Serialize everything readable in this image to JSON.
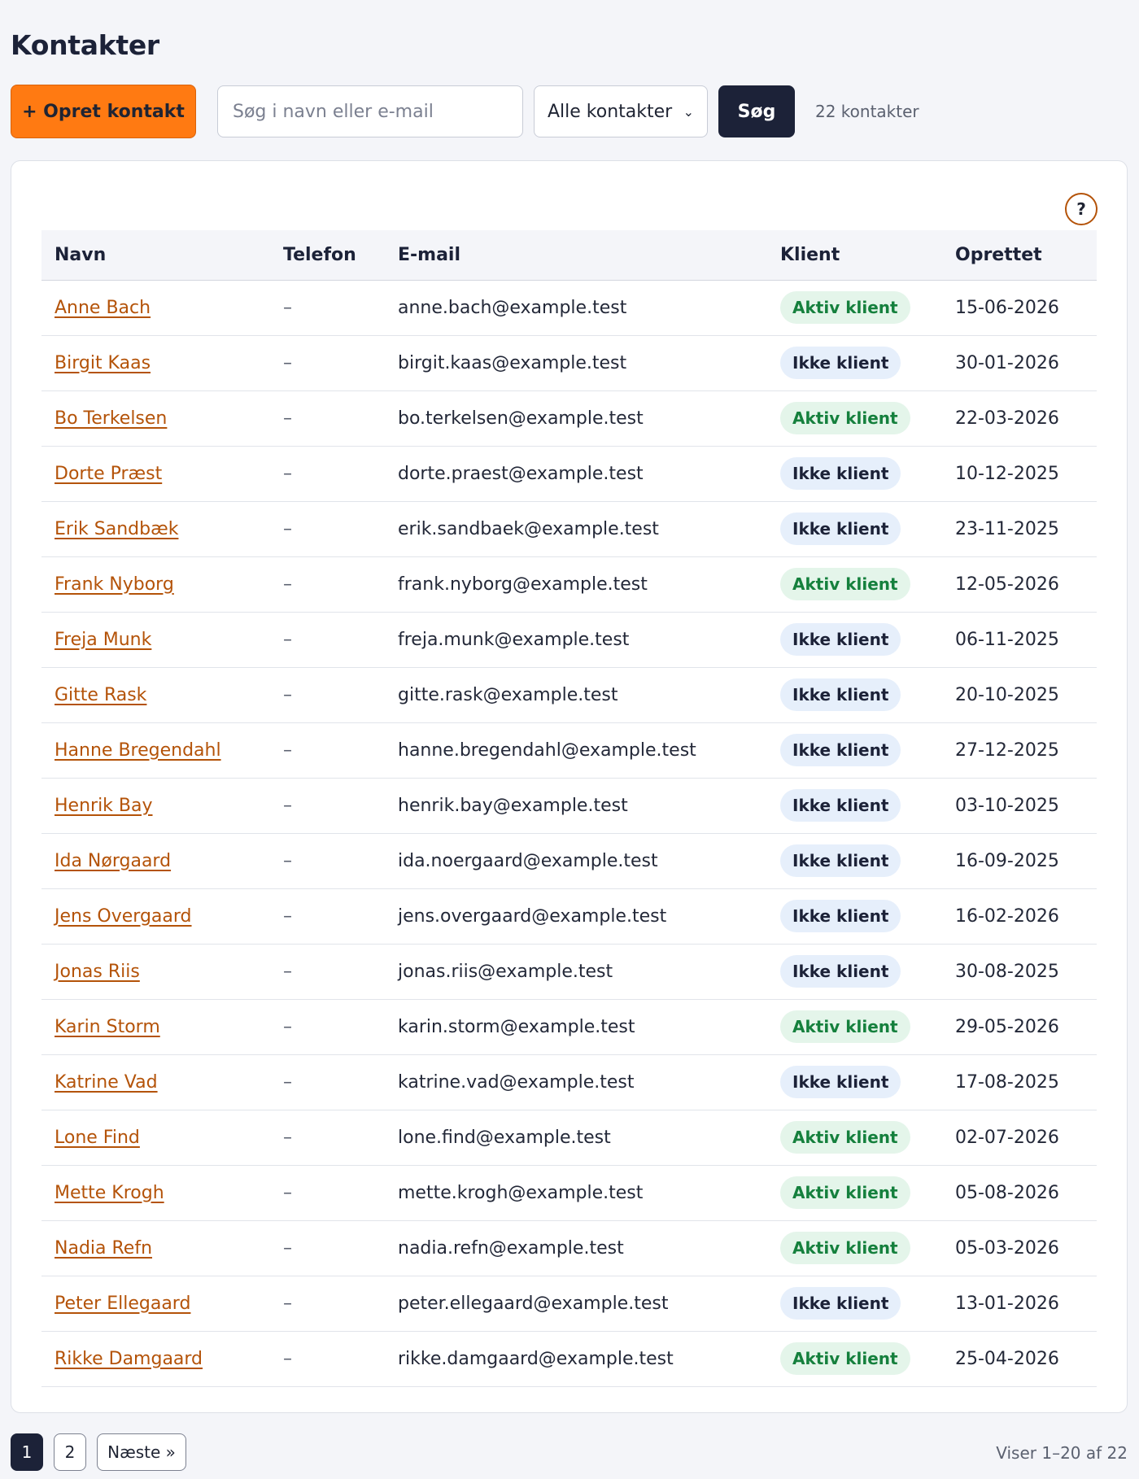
{
  "page_title": "Kontakter",
  "toolbar": {
    "create_label": "+ Opret kontakt",
    "search_placeholder": "Søg i navn eller e-mail",
    "filter_selected": "Alle kontakter",
    "search_label": "Søg",
    "count_text": "22 kontakter"
  },
  "help_icon": "?",
  "table": {
    "headers": [
      "Navn",
      "Telefon",
      "E-mail",
      "Klient",
      "Oprettet"
    ],
    "rows": [
      {
        "name": "Anne Bach",
        "phone": "–",
        "email": "anne.bach@example.test",
        "client": "Aktiv klient",
        "active": true,
        "created": "15-06-2026"
      },
      {
        "name": "Birgit Kaas",
        "phone": "–",
        "email": "birgit.kaas@example.test",
        "client": "Ikke klient",
        "active": false,
        "created": "30-01-2026"
      },
      {
        "name": "Bo Terkelsen",
        "phone": "–",
        "email": "bo.terkelsen@example.test",
        "client": "Aktiv klient",
        "active": true,
        "created": "22-03-2026"
      },
      {
        "name": "Dorte Præst",
        "phone": "–",
        "email": "dorte.praest@example.test",
        "client": "Ikke klient",
        "active": false,
        "created": "10-12-2025"
      },
      {
        "name": "Erik Sandbæk",
        "phone": "–",
        "email": "erik.sandbaek@example.test",
        "client": "Ikke klient",
        "active": false,
        "created": "23-11-2025"
      },
      {
        "name": "Frank Nyborg",
        "phone": "–",
        "email": "frank.nyborg@example.test",
        "client": "Aktiv klient",
        "active": true,
        "created": "12-05-2026"
      },
      {
        "name": "Freja Munk",
        "phone": "–",
        "email": "freja.munk@example.test",
        "client": "Ikke klient",
        "active": false,
        "created": "06-11-2025"
      },
      {
        "name": "Gitte Rask",
        "phone": "–",
        "email": "gitte.rask@example.test",
        "client": "Ikke klient",
        "active": false,
        "created": "20-10-2025"
      },
      {
        "name": "Hanne Bregendahl",
        "phone": "–",
        "email": "hanne.bregendahl@example.test",
        "client": "Ikke klient",
        "active": false,
        "created": "27-12-2025"
      },
      {
        "name": "Henrik Bay",
        "phone": "–",
        "email": "henrik.bay@example.test",
        "client": "Ikke klient",
        "active": false,
        "created": "03-10-2025"
      },
      {
        "name": "Ida Nørgaard",
        "phone": "–",
        "email": "ida.noergaard@example.test",
        "client": "Ikke klient",
        "active": false,
        "created": "16-09-2025"
      },
      {
        "name": "Jens Overgaard",
        "phone": "–",
        "email": "jens.overgaard@example.test",
        "client": "Ikke klient",
        "active": false,
        "created": "16-02-2026"
      },
      {
        "name": "Jonas Riis",
        "phone": "–",
        "email": "jonas.riis@example.test",
        "client": "Ikke klient",
        "active": false,
        "created": "30-08-2025"
      },
      {
        "name": "Karin Storm",
        "phone": "–",
        "email": "karin.storm@example.test",
        "client": "Aktiv klient",
        "active": true,
        "created": "29-05-2026"
      },
      {
        "name": "Katrine Vad",
        "phone": "–",
        "email": "katrine.vad@example.test",
        "client": "Ikke klient",
        "active": false,
        "created": "17-08-2025"
      },
      {
        "name": "Lone Find",
        "phone": "–",
        "email": "lone.find@example.test",
        "client": "Aktiv klient",
        "active": true,
        "created": "02-07-2026"
      },
      {
        "name": "Mette Krogh",
        "phone": "–",
        "email": "mette.krogh@example.test",
        "client": "Aktiv klient",
        "active": true,
        "created": "05-08-2026"
      },
      {
        "name": "Nadia Refn",
        "phone": "–",
        "email": "nadia.refn@example.test",
        "client": "Aktiv klient",
        "active": true,
        "created": "05-03-2026"
      },
      {
        "name": "Peter Ellegaard",
        "phone": "–",
        "email": "peter.ellegaard@example.test",
        "client": "Ikke klient",
        "active": false,
        "created": "13-01-2026"
      },
      {
        "name": "Rikke Damgaard",
        "phone": "–",
        "email": "rikke.damgaard@example.test",
        "client": "Aktiv klient",
        "active": true,
        "created": "25-04-2026"
      }
    ]
  },
  "pagination": {
    "pages": [
      "1",
      "2"
    ],
    "current": "1",
    "next_label": "Næste »",
    "status": "Viser 1–20 af 22"
  },
  "colors": {
    "accent": "#ff7a12",
    "link": "#b45309",
    "dark": "#1c2238",
    "active_badge_bg": "#e4f5ea",
    "active_badge_text": "#15803d",
    "inactive_badge_bg": "#e6effb"
  }
}
